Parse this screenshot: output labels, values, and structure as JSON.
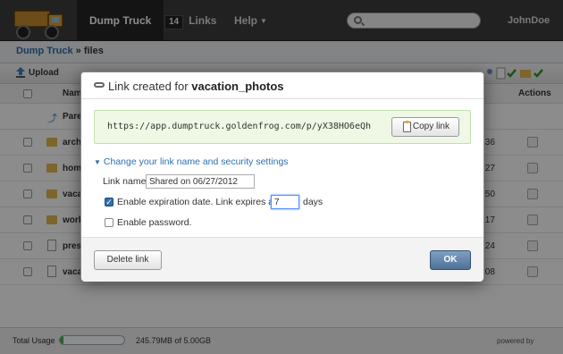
{
  "nav": {
    "brand": "Dump Truck",
    "links_count": "14",
    "links_label": "Links",
    "help_label": "Help",
    "user": "JohnDoe",
    "search_placeholder": ""
  },
  "breadcrumb": {
    "root": "Dump Truck",
    "sep": " » ",
    "current": "files"
  },
  "toolbar": {
    "upload_label": "Upload"
  },
  "table": {
    "name_header": "Nam",
    "actions_header": "Actions",
    "parent_label": "Pare",
    "rows": [
      {
        "name": "arch",
        "time": ":36",
        "kind": "folder"
      },
      {
        "name": "hom",
        "time": ":27",
        "kind": "folder"
      },
      {
        "name": "vaca",
        "time": ":50",
        "kind": "folder"
      },
      {
        "name": "work",
        "time": ":17",
        "kind": "folder"
      },
      {
        "name": "pres",
        "time": ":24",
        "kind": "doc"
      },
      {
        "name": "vaca",
        "time": ":08",
        "kind": "doc"
      }
    ]
  },
  "footer": {
    "usage_label": "Total Usage",
    "usage_fraction": 0.05,
    "usage_text": "245.79MB of 5.00GB",
    "powered": "powered by"
  },
  "modal": {
    "title_prefix": "Link created for",
    "title_name": "vacation_photos",
    "url": "https://app.dumptruck.goldenfrog.com/p/yX38HO6eQh",
    "copy_label": "Copy link",
    "settings_toggle": "Change your link name and security settings",
    "link_name_label": "Link name:",
    "link_name_value": "Shared on 06/27/2012",
    "expiration_label": "Enable expiration date.  Link expires after",
    "expiration_days": "7",
    "days_label": "days",
    "expiration_checked": true,
    "password_label": "Enable password.",
    "password_checked": false,
    "delete_label": "Delete link",
    "ok_label": "OK"
  }
}
